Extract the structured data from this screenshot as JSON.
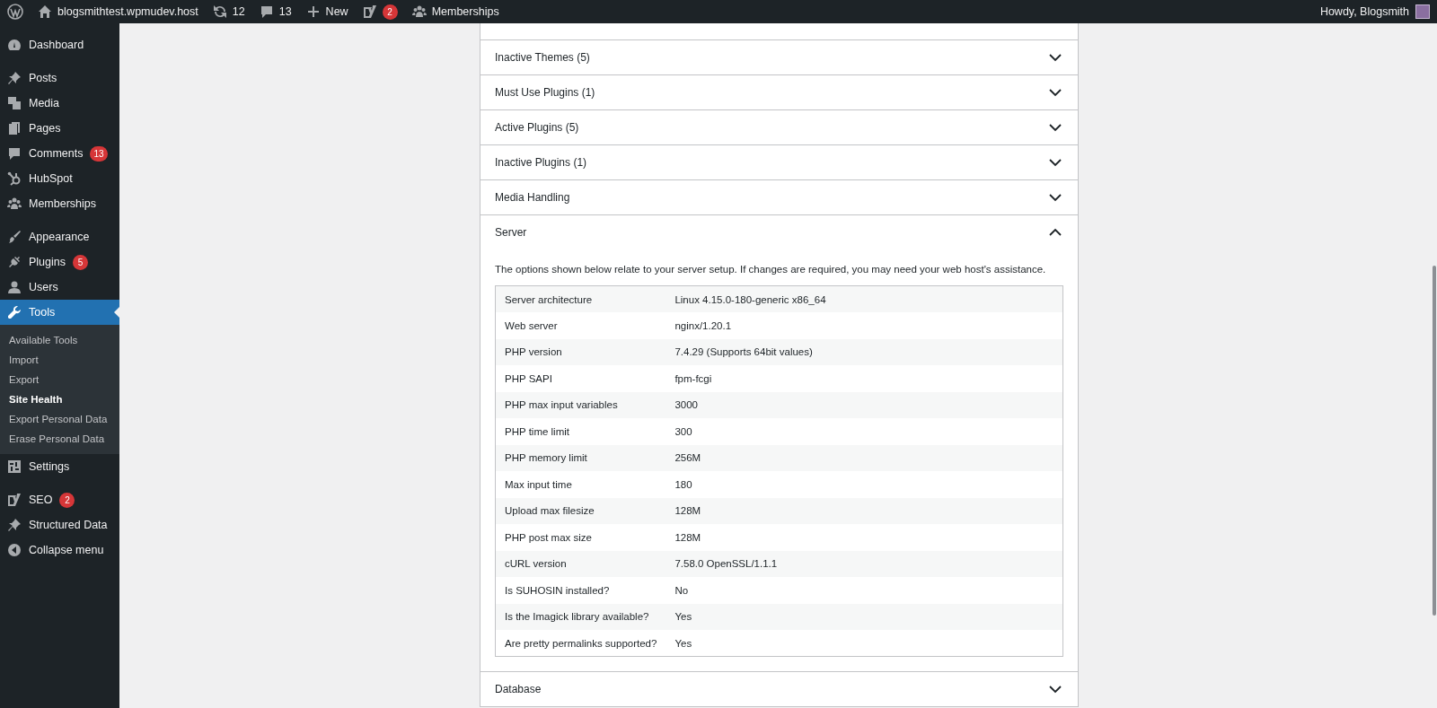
{
  "admin_bar": {
    "items": [
      {
        "kind": "wp-logo"
      },
      {
        "kind": "site",
        "label": "blogsmithtest.wpmudev.host"
      },
      {
        "kind": "updates",
        "label": "12"
      },
      {
        "kind": "comments",
        "label": "13"
      },
      {
        "kind": "new",
        "label": "New"
      },
      {
        "kind": "seo",
        "badge": "2"
      },
      {
        "kind": "memberships",
        "label": "Memberships"
      }
    ],
    "account": {
      "label": "Howdy, Blogsmith"
    }
  },
  "sidebar": {
    "groups": [
      [
        {
          "label": "Dashboard",
          "kind": "dashboard",
          "selected": false
        }
      ],
      [
        {
          "label": "Posts",
          "kind": "pin",
          "selected": false
        },
        {
          "label": "Media",
          "kind": "media",
          "selected": false
        },
        {
          "label": "Pages",
          "kind": "pages",
          "selected": false
        },
        {
          "label": "Comments",
          "kind": "comment",
          "badge": "13",
          "selected": false
        },
        {
          "label": "HubSpot",
          "kind": "hubspot",
          "selected": false
        },
        {
          "label": "Memberships",
          "kind": "group",
          "selected": false
        }
      ],
      [
        {
          "label": "Appearance",
          "kind": "brush",
          "selected": false
        },
        {
          "label": "Plugins",
          "kind": "plug",
          "badge": "5",
          "selected": false
        },
        {
          "label": "Users",
          "kind": "user",
          "selected": false
        },
        {
          "label": "Tools",
          "kind": "wrench",
          "selected": true,
          "children": [
            {
              "label": "Available Tools",
              "selected": false
            },
            {
              "label": "Import",
              "selected": false
            },
            {
              "label": "Export",
              "selected": false
            },
            {
              "label": "Site Health",
              "selected": true
            },
            {
              "label": "Export Personal Data",
              "selected": false
            },
            {
              "label": "Erase Personal Data",
              "selected": false
            }
          ]
        },
        {
          "label": "Settings",
          "kind": "settings",
          "selected": false
        }
      ],
      [
        {
          "label": "SEO",
          "kind": "seo",
          "badge": "2",
          "selected": false
        },
        {
          "label": "Structured Data",
          "kind": "pin",
          "selected": false
        },
        {
          "label": "Collapse menu",
          "kind": "collapse",
          "selected": false
        }
      ]
    ]
  },
  "sections": [
    {
      "title": "Inactive Themes (5)",
      "expanded": false
    },
    {
      "title": "Must Use Plugins (1)",
      "expanded": false
    },
    {
      "title": "Active Plugins (5)",
      "expanded": false
    },
    {
      "title": "Inactive Plugins (1)",
      "expanded": false
    },
    {
      "title": "Media Handling",
      "expanded": false
    },
    {
      "title": "Server",
      "expanded": true,
      "description": "The options shown below relate to your server setup. If changes are required, you may need your web host's assistance.",
      "rows": [
        [
          "Server architecture",
          "Linux 4.15.0-180-generic x86_64"
        ],
        [
          "Web server",
          "nginx/1.20.1"
        ],
        [
          "PHP version",
          "7.4.29 (Supports 64bit values)"
        ],
        [
          "PHP SAPI",
          "fpm-fcgi"
        ],
        [
          "PHP max input variables",
          "3000"
        ],
        [
          "PHP time limit",
          "300"
        ],
        [
          "PHP memory limit",
          "256M"
        ],
        [
          "Max input time",
          "180"
        ],
        [
          "Upload max filesize",
          "128M"
        ],
        [
          "PHP post max size",
          "128M"
        ],
        [
          "cURL version",
          "7.58.0 OpenSSL/1.1.1"
        ],
        [
          "Is SUHOSIN installed?",
          "No"
        ],
        [
          "Is the Imagick library available?",
          "Yes"
        ],
        [
          "Are pretty permalinks supported?",
          "Yes"
        ]
      ]
    },
    {
      "title": "Database",
      "expanded": false
    }
  ]
}
